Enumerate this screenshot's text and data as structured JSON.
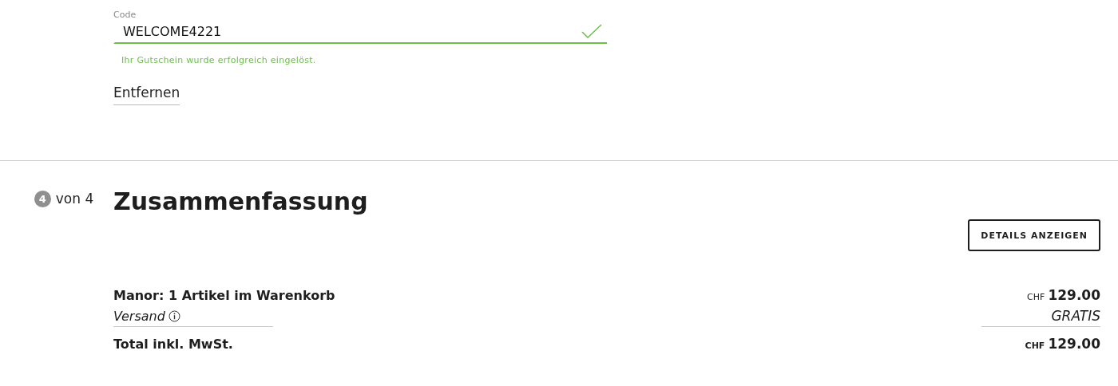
{
  "coupon": {
    "label": "Code",
    "value": "WELCOME4221",
    "valid": true,
    "message": "Ihr Gutschein wurde erfolgreich eingelöst."
  },
  "remove_link": "Entfernen",
  "step": {
    "number": "4",
    "text": "von 4"
  },
  "heading": "Zusammenfassung",
  "details_button": "DETAILS ANZEIGEN",
  "rows": [
    {
      "kind": "item",
      "label": "Manor: 1 Artikel im Warenkorb",
      "currency": "CHF",
      "amount": "129.00"
    },
    {
      "kind": "shipping",
      "label": "Versand",
      "amount": "GRATIS"
    },
    {
      "kind": "total",
      "label": "Total inkl. MwSt.",
      "currency": "CHF",
      "amount": "129.00"
    }
  ]
}
